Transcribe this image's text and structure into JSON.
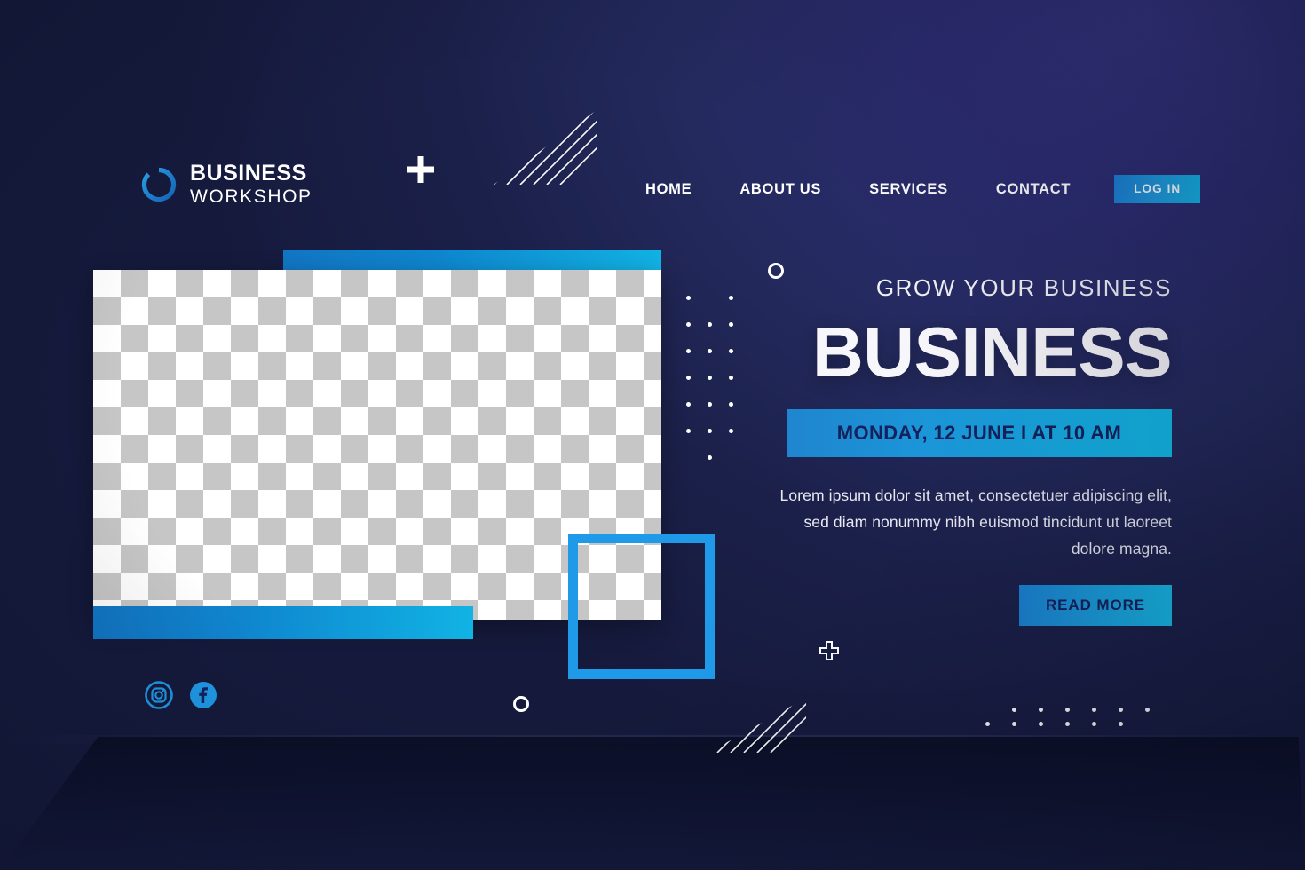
{
  "brand": {
    "logo_icon": "circular-ring-icon",
    "line1": "BUSINESS",
    "line2": "WORKSHOP"
  },
  "nav": {
    "items": [
      {
        "label": "HOME"
      },
      {
        "label": "ABOUT US"
      },
      {
        "label": "SERVICES"
      },
      {
        "label": "CONTACT"
      }
    ],
    "login_label": "LOG IN"
  },
  "hero": {
    "eyebrow": "GROW YOUR BUSINESS",
    "headline": "BUSINESS",
    "date_banner": "MONDAY, 12 JUNE I AT 10 AM",
    "paragraph": "Lorem ipsum dolor sit amet, consectetuer adipiscing elit, sed diam nonummy nibh euismod tincidunt ut laoreet dolore magna.",
    "cta_label": "READ MORE"
  },
  "media": {
    "placeholder_label": "image-placeholder-checkerboard"
  },
  "social": {
    "items": [
      {
        "name": "instagram-icon"
      },
      {
        "name": "facebook-icon"
      }
    ]
  },
  "decorations": [
    {
      "name": "plus-filled-icon"
    },
    {
      "name": "diagonal-stripes-top"
    },
    {
      "name": "circle-outline-top"
    },
    {
      "name": "dot-grid-left"
    },
    {
      "name": "plus-outline-icon"
    },
    {
      "name": "circle-outline-bottom"
    },
    {
      "name": "diagonal-stripes-bottom"
    },
    {
      "name": "dot-grid-right"
    },
    {
      "name": "outline-square"
    }
  ],
  "colors": {
    "background_dark": "#151a3c",
    "background_purple": "#34337f",
    "accent_blue": "#1a7fcf",
    "accent_cyan": "#12bbe9",
    "outline_blue": "#1f9ae8",
    "text_light": "#f7f7fb",
    "text_on_accent": "#15215c"
  }
}
